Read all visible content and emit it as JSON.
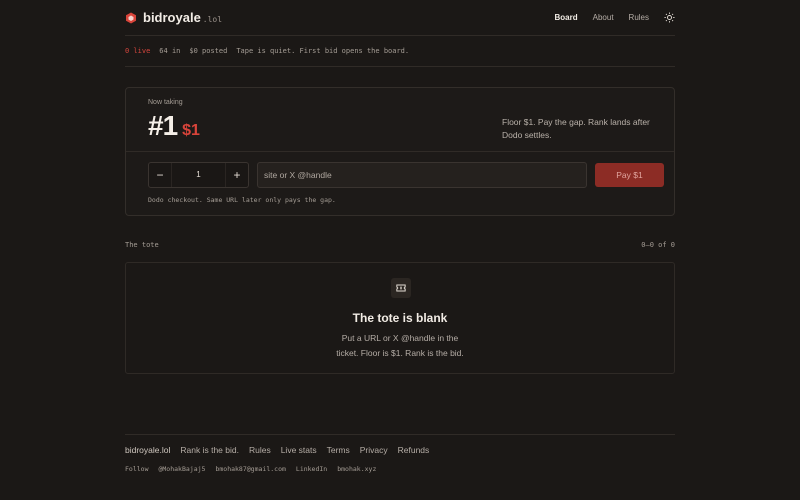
{
  "brand": {
    "name": "bidroyale",
    "tld": ".lol",
    "accent": "#d9443a"
  },
  "nav": {
    "items": [
      "Board",
      "About",
      "Rules"
    ],
    "active": "Board",
    "theme_icon": "sun-icon"
  },
  "tape": {
    "live": "0 live",
    "count_in": "64 in",
    "posted": "$0 posted",
    "message": "Tape is quiet. First bid opens the board."
  },
  "ticket": {
    "now_label": "Now taking",
    "rank": "#1",
    "price": "$1",
    "floor_note": "Floor $1. Pay the gap. Rank lands after Dodo settles.",
    "quantity": "1",
    "minus": "−",
    "plus": "+",
    "handle_placeholder": "site or X @handle",
    "pay_label": "Pay $1",
    "checkout_note": "Dodo checkout. Same URL later only pays the gap."
  },
  "tote": {
    "label": "The tote",
    "count": "0–0 of 0",
    "title": "The tote is blank",
    "body_line1": "Put a URL or X @handle in the",
    "body_line2": "ticket. Floor is $1. Rank is the bid."
  },
  "footer": {
    "brand": "bidroyale.lol",
    "tagline": "Rank is the bid.",
    "links": [
      "Rules",
      "Live stats",
      "Terms",
      "Privacy",
      "Refunds"
    ],
    "follow_label": "Follow",
    "socials": [
      "@MohakBajaj5",
      "bmohak87@gmail.com",
      "LinkedIn",
      "bmohak.xyz"
    ]
  }
}
